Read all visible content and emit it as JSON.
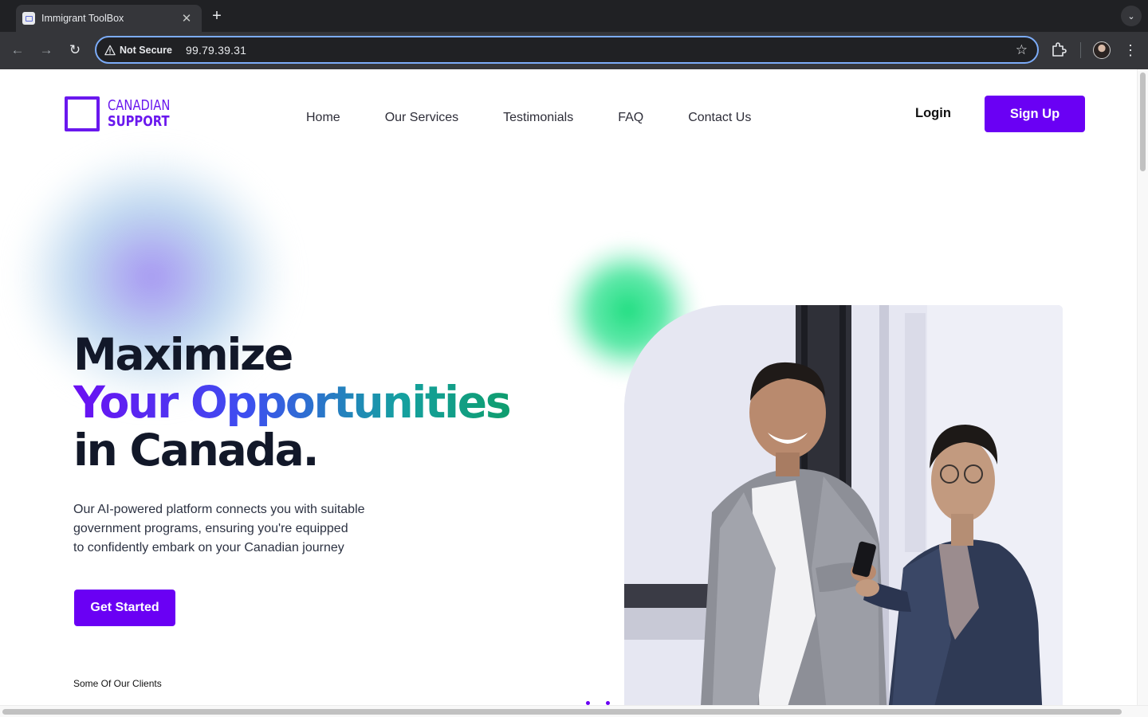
{
  "browser": {
    "tab_title": "Immigrant ToolBox",
    "new_tab": "+",
    "security_label": "Not Secure",
    "url": "99.79.39.31"
  },
  "site": {
    "logo": {
      "line1": "CANADIAN",
      "line2": "SUPPORT"
    },
    "nav": [
      "Home",
      "Our Services",
      "Testimonials",
      "FAQ",
      "Contact Us"
    ],
    "login": "Login",
    "signup": "Sign Up"
  },
  "hero": {
    "title_line1": "Maximize",
    "title_line2": "Your Opportunities",
    "title_line3": "in Canada.",
    "subtitle_lines": [
      "Our AI-powered platform connects you with suitable",
      "government programs, ensuring you're equipped",
      "to confidently embark on your Canadian journey"
    ],
    "cta": "Get Started",
    "clients_label": "Some Of Our Clients"
  },
  "colors": {
    "brand": "#6a00f4",
    "heading": "#121829",
    "gradient_start": "#6a0ff2",
    "gradient_end": "#0f9d6e",
    "blob_green": "#22de82"
  },
  "icons": {
    "back": "arrow-left-icon",
    "forward": "arrow-right-icon",
    "reload": "reload-icon",
    "warning": "warning-triangle-icon",
    "bookmark": "star-icon",
    "extensions": "puzzle-icon",
    "menu": "kebab-menu-icon"
  }
}
